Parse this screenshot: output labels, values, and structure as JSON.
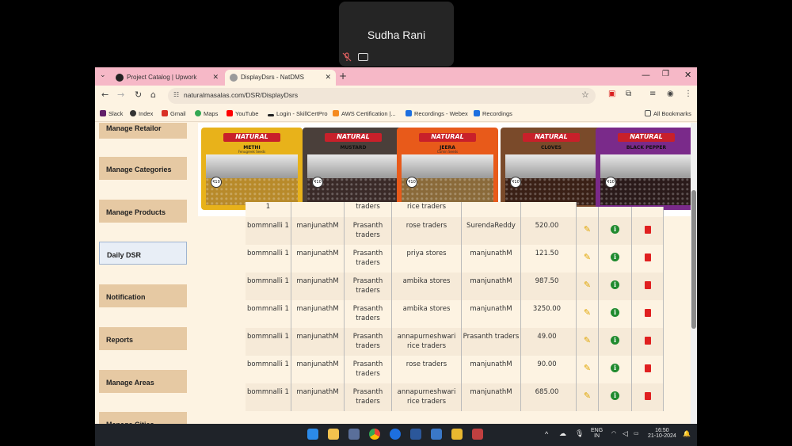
{
  "call": {
    "participant_name": "Sudha Rani"
  },
  "browser": {
    "tabs": [
      {
        "label": "Project Catalog | Upwork",
        "active": false
      },
      {
        "label": "DisplayDsrs - NatDMS",
        "active": true
      }
    ],
    "new_tab": "+",
    "url": "naturalmasalas.com/DSR/DisplayDsrs",
    "bookmarks": [
      "Slack",
      "Index",
      "Gmail",
      "Maps",
      "YouTube",
      "Login - SkillCertPro",
      "AWS Certification |...",
      "Recordings - Webex",
      "Recordings"
    ],
    "all_bookmarks": "All Bookmarks"
  },
  "sidebar": {
    "items": [
      {
        "label": "Manage Retailor"
      },
      {
        "label": "Manage Categories"
      },
      {
        "label": "Manage Products"
      },
      {
        "label": "Daily DSR"
      },
      {
        "label": "Notification"
      },
      {
        "label": "Reports"
      },
      {
        "label": "Manage Areas"
      },
      {
        "label": "Manage Cities"
      }
    ]
  },
  "banner": {
    "brand": "NATURAL",
    "packs": [
      {
        "name": "METHI",
        "sub": "Fenugreek Seeds",
        "price": "₹10",
        "color": "#e8b21a",
        "seed": "#b88a2a"
      },
      {
        "name": "MUSTARD",
        "sub": "",
        "price": "₹10",
        "color": "#4a3f3a",
        "seed": "#3a2a28"
      },
      {
        "name": "JEERA",
        "sub": "Cumin Seeds",
        "price": "₹10",
        "color": "#e85a1a",
        "seed": "#8a6a3a"
      },
      {
        "name": "CLOVES",
        "sub": "",
        "price": "₹10",
        "color": "#7a4a2a",
        "seed": "#3a2016"
      },
      {
        "name": "BLACK PEPPER",
        "sub": "",
        "price": "₹10",
        "color": "#7a2a8a",
        "seed": "#2a1a1a"
      }
    ]
  },
  "table": {
    "partial_row": [
      "1",
      "",
      "traders",
      "rice traders",
      "",
      ""
    ],
    "rows": [
      [
        "bommnalli 1",
        "manjunathM",
        "Prasanth traders",
        "rose traders",
        "SurendaReddy",
        "520.00"
      ],
      [
        "bommnalli 1",
        "manjunathM",
        "Prasanth traders",
        "priya stores",
        "manjunathM",
        "121.50"
      ],
      [
        "bommnalli 1",
        "manjunathM",
        "Prasanth traders",
        "ambika stores",
        "manjunathM",
        "987.50"
      ],
      [
        "bommnalli 1",
        "manjunathM",
        "Prasanth traders",
        "ambika stores",
        "manjunathM",
        "3250.00"
      ],
      [
        "bommnalli 1",
        "manjunathM",
        "Prasanth traders",
        "annapurneshwari rice traders",
        "Prasanth traders",
        "49.00"
      ],
      [
        "bommnalli 1",
        "manjunathM",
        "Prasanth traders",
        "rose traders",
        "manjunathM",
        "90.00"
      ],
      [
        "bommnalli 1",
        "manjunathM",
        "Prasanth traders",
        "annapurneshwari rice traders",
        "manjunathM",
        "685.00"
      ]
    ]
  },
  "taskbar": {
    "lang": "ENG",
    "region": "IN",
    "time": "16:50",
    "date": "21-10-2024"
  }
}
